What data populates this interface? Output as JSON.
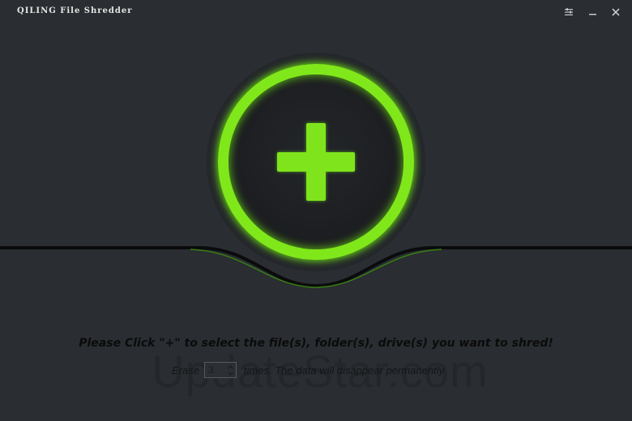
{
  "window": {
    "title": "QILING File Shredder"
  },
  "main": {
    "instruction": "Please Click \"+\" to select the file(s), folder(s), drive(s) you want to shred!",
    "erase_label": "Erase",
    "erase_times_value": "3",
    "times_label": "times. The data will disappear permanently"
  },
  "watermark": {
    "text": "UpdateStar.com"
  },
  "icons": {
    "menu": "settings-menu-icon",
    "minimize": "minimize-icon",
    "close": "close-icon",
    "add": "plus-icon"
  },
  "colors": {
    "background": "#2a2d31",
    "accent": "#80e81a",
    "text_dark": "#0b0b0b"
  }
}
